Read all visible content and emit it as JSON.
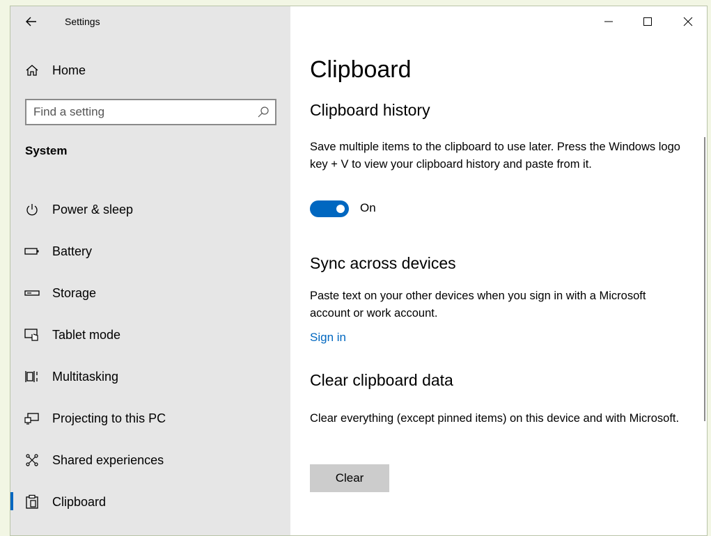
{
  "window": {
    "title": "Settings"
  },
  "sidebar": {
    "home_label": "Home",
    "search_placeholder": "Find a setting",
    "section_label": "System",
    "items": [
      {
        "label": "Power & sleep",
        "icon": "power-icon"
      },
      {
        "label": "Battery",
        "icon": "battery-icon"
      },
      {
        "label": "Storage",
        "icon": "storage-icon"
      },
      {
        "label": "Tablet mode",
        "icon": "tablet-mode-icon"
      },
      {
        "label": "Multitasking",
        "icon": "multitasking-icon"
      },
      {
        "label": "Projecting to this PC",
        "icon": "projecting-icon"
      },
      {
        "label": "Shared experiences",
        "icon": "shared-experiences-icon"
      },
      {
        "label": "Clipboard",
        "icon": "clipboard-icon",
        "selected": true
      }
    ]
  },
  "main": {
    "page_title": "Clipboard",
    "history": {
      "heading": "Clipboard history",
      "description": "Save multiple items to the clipboard to use later. Press the Windows logo key + V to view your clipboard history and paste from it.",
      "toggle_state": "On"
    },
    "sync": {
      "heading": "Sync across devices",
      "description": "Paste text on your other devices when you sign in with a Microsoft account or work account.",
      "link": "Sign in"
    },
    "clear": {
      "heading": "Clear clipboard data",
      "description": "Clear everything (except pinned items) on this device and with Microsoft.",
      "button": "Clear"
    }
  },
  "colors": {
    "accent": "#0067c0",
    "sidebar_bg": "#e6e6e6",
    "button_bg": "#cccccc"
  }
}
